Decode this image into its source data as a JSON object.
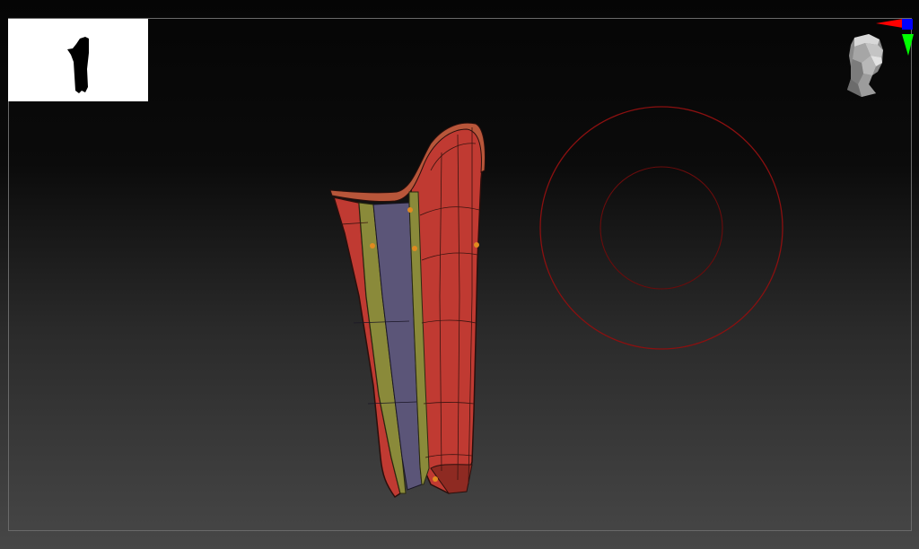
{
  "viewport": {
    "background_top": "#050505",
    "background_bottom": "#474747",
    "frame_color": "#6a6a6a"
  },
  "thumbnail": {
    "icon": "model-silhouette-icon",
    "background": "#ffffff",
    "silhouette_color": "#000000"
  },
  "navigation": {
    "head_icon": "head-navigation-icon",
    "axis_icon": "axis-gizmo-icon",
    "axis_colors": {
      "x": "#ff0000",
      "y": "#00ff00",
      "z": "#0000ff"
    }
  },
  "model": {
    "icon": "shin-guard-mesh-icon",
    "colors": {
      "body": "#c03a32",
      "body_dark": "#8e2a22",
      "panel": "#5b5578",
      "trim": "#8a8a3a",
      "rim": "#b8563a",
      "handle": "#e08a20"
    }
  },
  "brush": {
    "icon": "brush-cursor-icon",
    "color": "#8b1010"
  }
}
